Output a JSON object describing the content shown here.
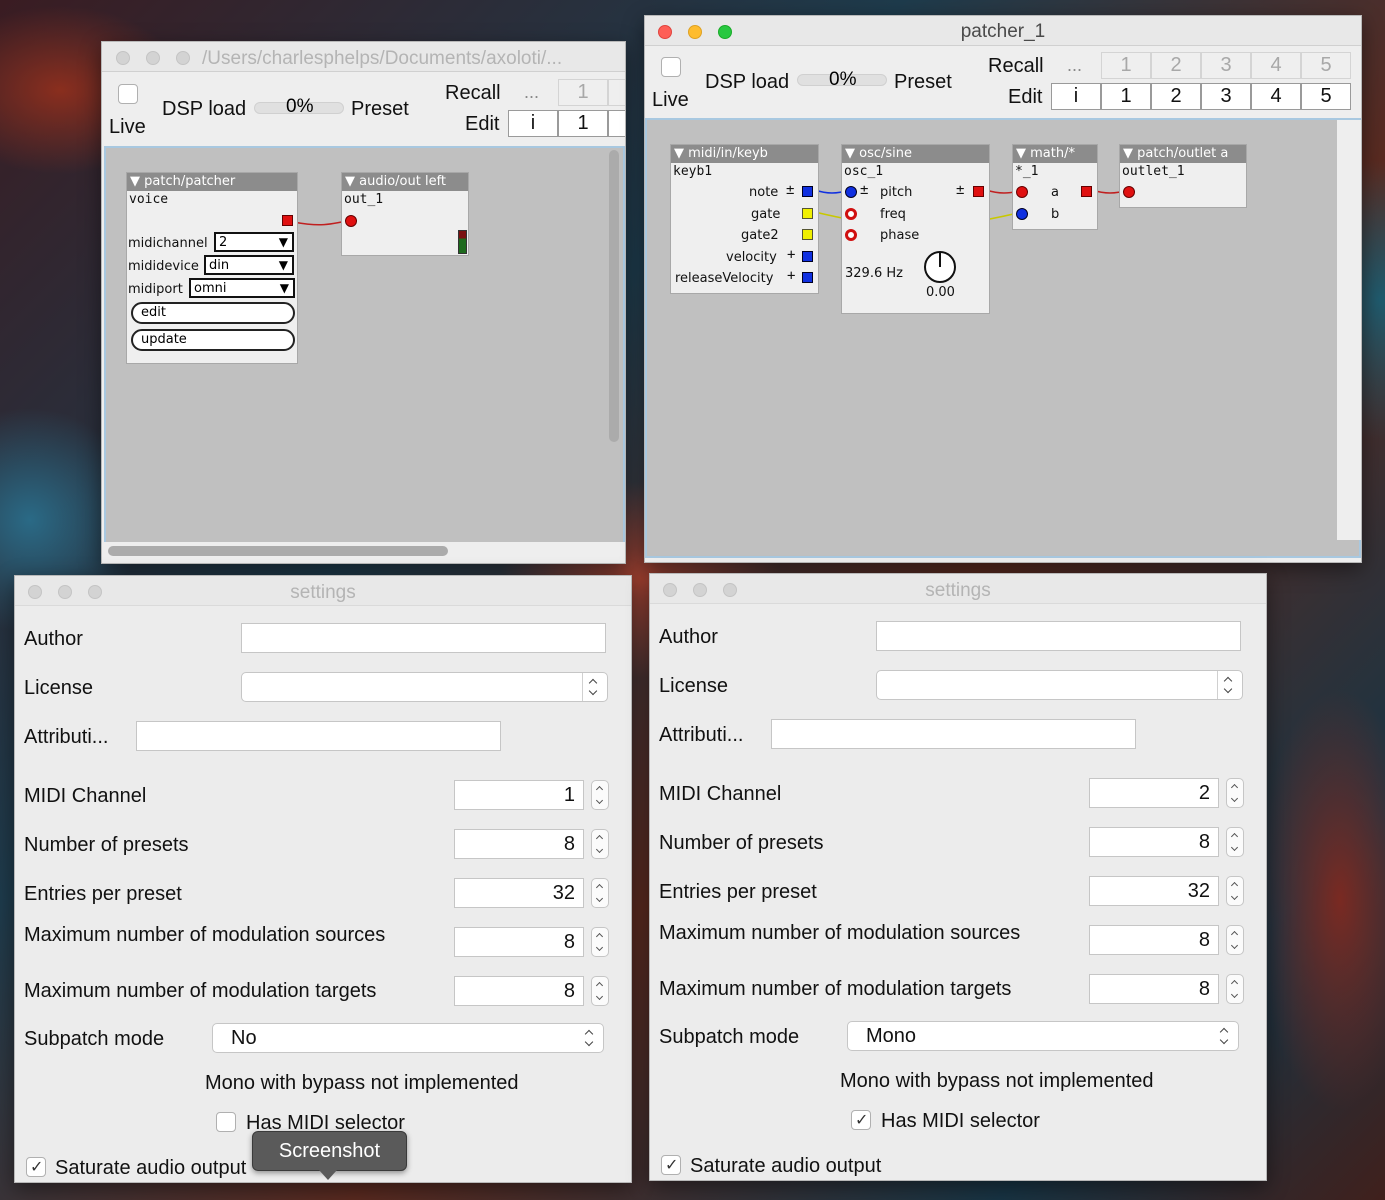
{
  "window1": {
    "title": "/Users/charlesphelps/Documents/axoloti/...",
    "toolbar": {
      "live_label": "Live",
      "dsp_label": "DSP load",
      "dsp_value": "0%",
      "preset_label": "Preset",
      "recall_label": "Recall",
      "edit_label": "Edit",
      "ellipsis": "...",
      "info": "i",
      "recall_cells": [
        "1"
      ],
      "edit_cells": [
        "1"
      ]
    },
    "objects": {
      "patcher": {
        "header": "patch/patcher",
        "instance": "voice",
        "midichannel_label": "midichannel",
        "midichannel_value": "2",
        "mididevice_label": "mididevice",
        "mididevice_value": "din",
        "midiport_label": "midiport",
        "midiport_value": "omni",
        "edit_button": "edit",
        "update_button": "update"
      },
      "audio_out": {
        "header": "audio/out left",
        "instance": "out_1"
      }
    }
  },
  "window2": {
    "title": "patcher_1",
    "toolbar": {
      "live_label": "Live",
      "dsp_label": "DSP load",
      "dsp_value": "0%",
      "preset_label": "Preset",
      "recall_label": "Recall",
      "edit_label": "Edit",
      "ellipsis": "...",
      "info": "i",
      "recall_cells": [
        "1",
        "2",
        "3",
        "4",
        "5"
      ],
      "edit_cells": [
        "1",
        "2",
        "3",
        "4",
        "5"
      ]
    },
    "objects": {
      "keyb": {
        "header": "midi/in/keyb",
        "instance": "keyb1",
        "outlets": [
          "note",
          "gate",
          "gate2",
          "velocity",
          "releaseVelocity"
        ]
      },
      "osc": {
        "header": "osc/sine",
        "instance": "osc_1",
        "inlets": [
          "pitch",
          "freq",
          "phase"
        ],
        "freq_readout": "329.6 Hz",
        "knob_value": "0.00"
      },
      "math": {
        "header": "math/*",
        "instance": "*_1",
        "inlets": [
          "a",
          "b"
        ]
      },
      "outlet": {
        "header": "patch/outlet a",
        "instance": "outlet_1"
      }
    }
  },
  "settings_left": {
    "title": "settings",
    "author_label": "Author",
    "author_value": "",
    "license_label": "License",
    "license_value": "",
    "attribution_label": "Attributi...",
    "attribution_value": "",
    "midi_channel_label": "MIDI Channel",
    "midi_channel_value": "1",
    "presets_label": "Number of presets",
    "presets_value": "8",
    "entries_label": "Entries per preset",
    "entries_value": "32",
    "mod_sources_label": "Maximum number of modulation sources",
    "mod_sources_value": "8",
    "mod_targets_label": "Maximum number of modulation targets",
    "mod_targets_value": "8",
    "subpatch_label": "Subpatch mode",
    "subpatch_value": "No",
    "note": "Mono with bypass not implemented",
    "midi_selector_label": "Has MIDI selector",
    "midi_selector_checked": false,
    "saturate_label": "Saturate audio output",
    "saturate_checked": true
  },
  "settings_right": {
    "title": "settings",
    "author_label": "Author",
    "author_value": "",
    "license_label": "License",
    "license_value": "",
    "attribution_label": "Attributi...",
    "attribution_value": "",
    "midi_channel_label": "MIDI Channel",
    "midi_channel_value": "2",
    "presets_label": "Number of presets",
    "presets_value": "8",
    "entries_label": "Entries per preset",
    "entries_value": "32",
    "mod_sources_label": "Maximum number of modulation sources",
    "mod_sources_value": "8",
    "mod_targets_label": "Maximum number of modulation targets",
    "mod_targets_value": "8",
    "subpatch_label": "Subpatch mode",
    "subpatch_value": "Mono",
    "note": "Mono with bypass not implemented",
    "midi_selector_label": "Has MIDI selector",
    "midi_selector_checked": true,
    "saturate_label": "Saturate audio output",
    "saturate_checked": true
  },
  "tooltip": {
    "text": "Screenshot"
  },
  "colors": {
    "red_pin": "#e01010",
    "blue_pin": "#1030e0",
    "yellow_pin": "#f0f000",
    "canvas": "#c0c0c0",
    "wire_red": "#c02020",
    "wire_blue": "#1030e0",
    "wire_yellow": "#c8c800"
  }
}
